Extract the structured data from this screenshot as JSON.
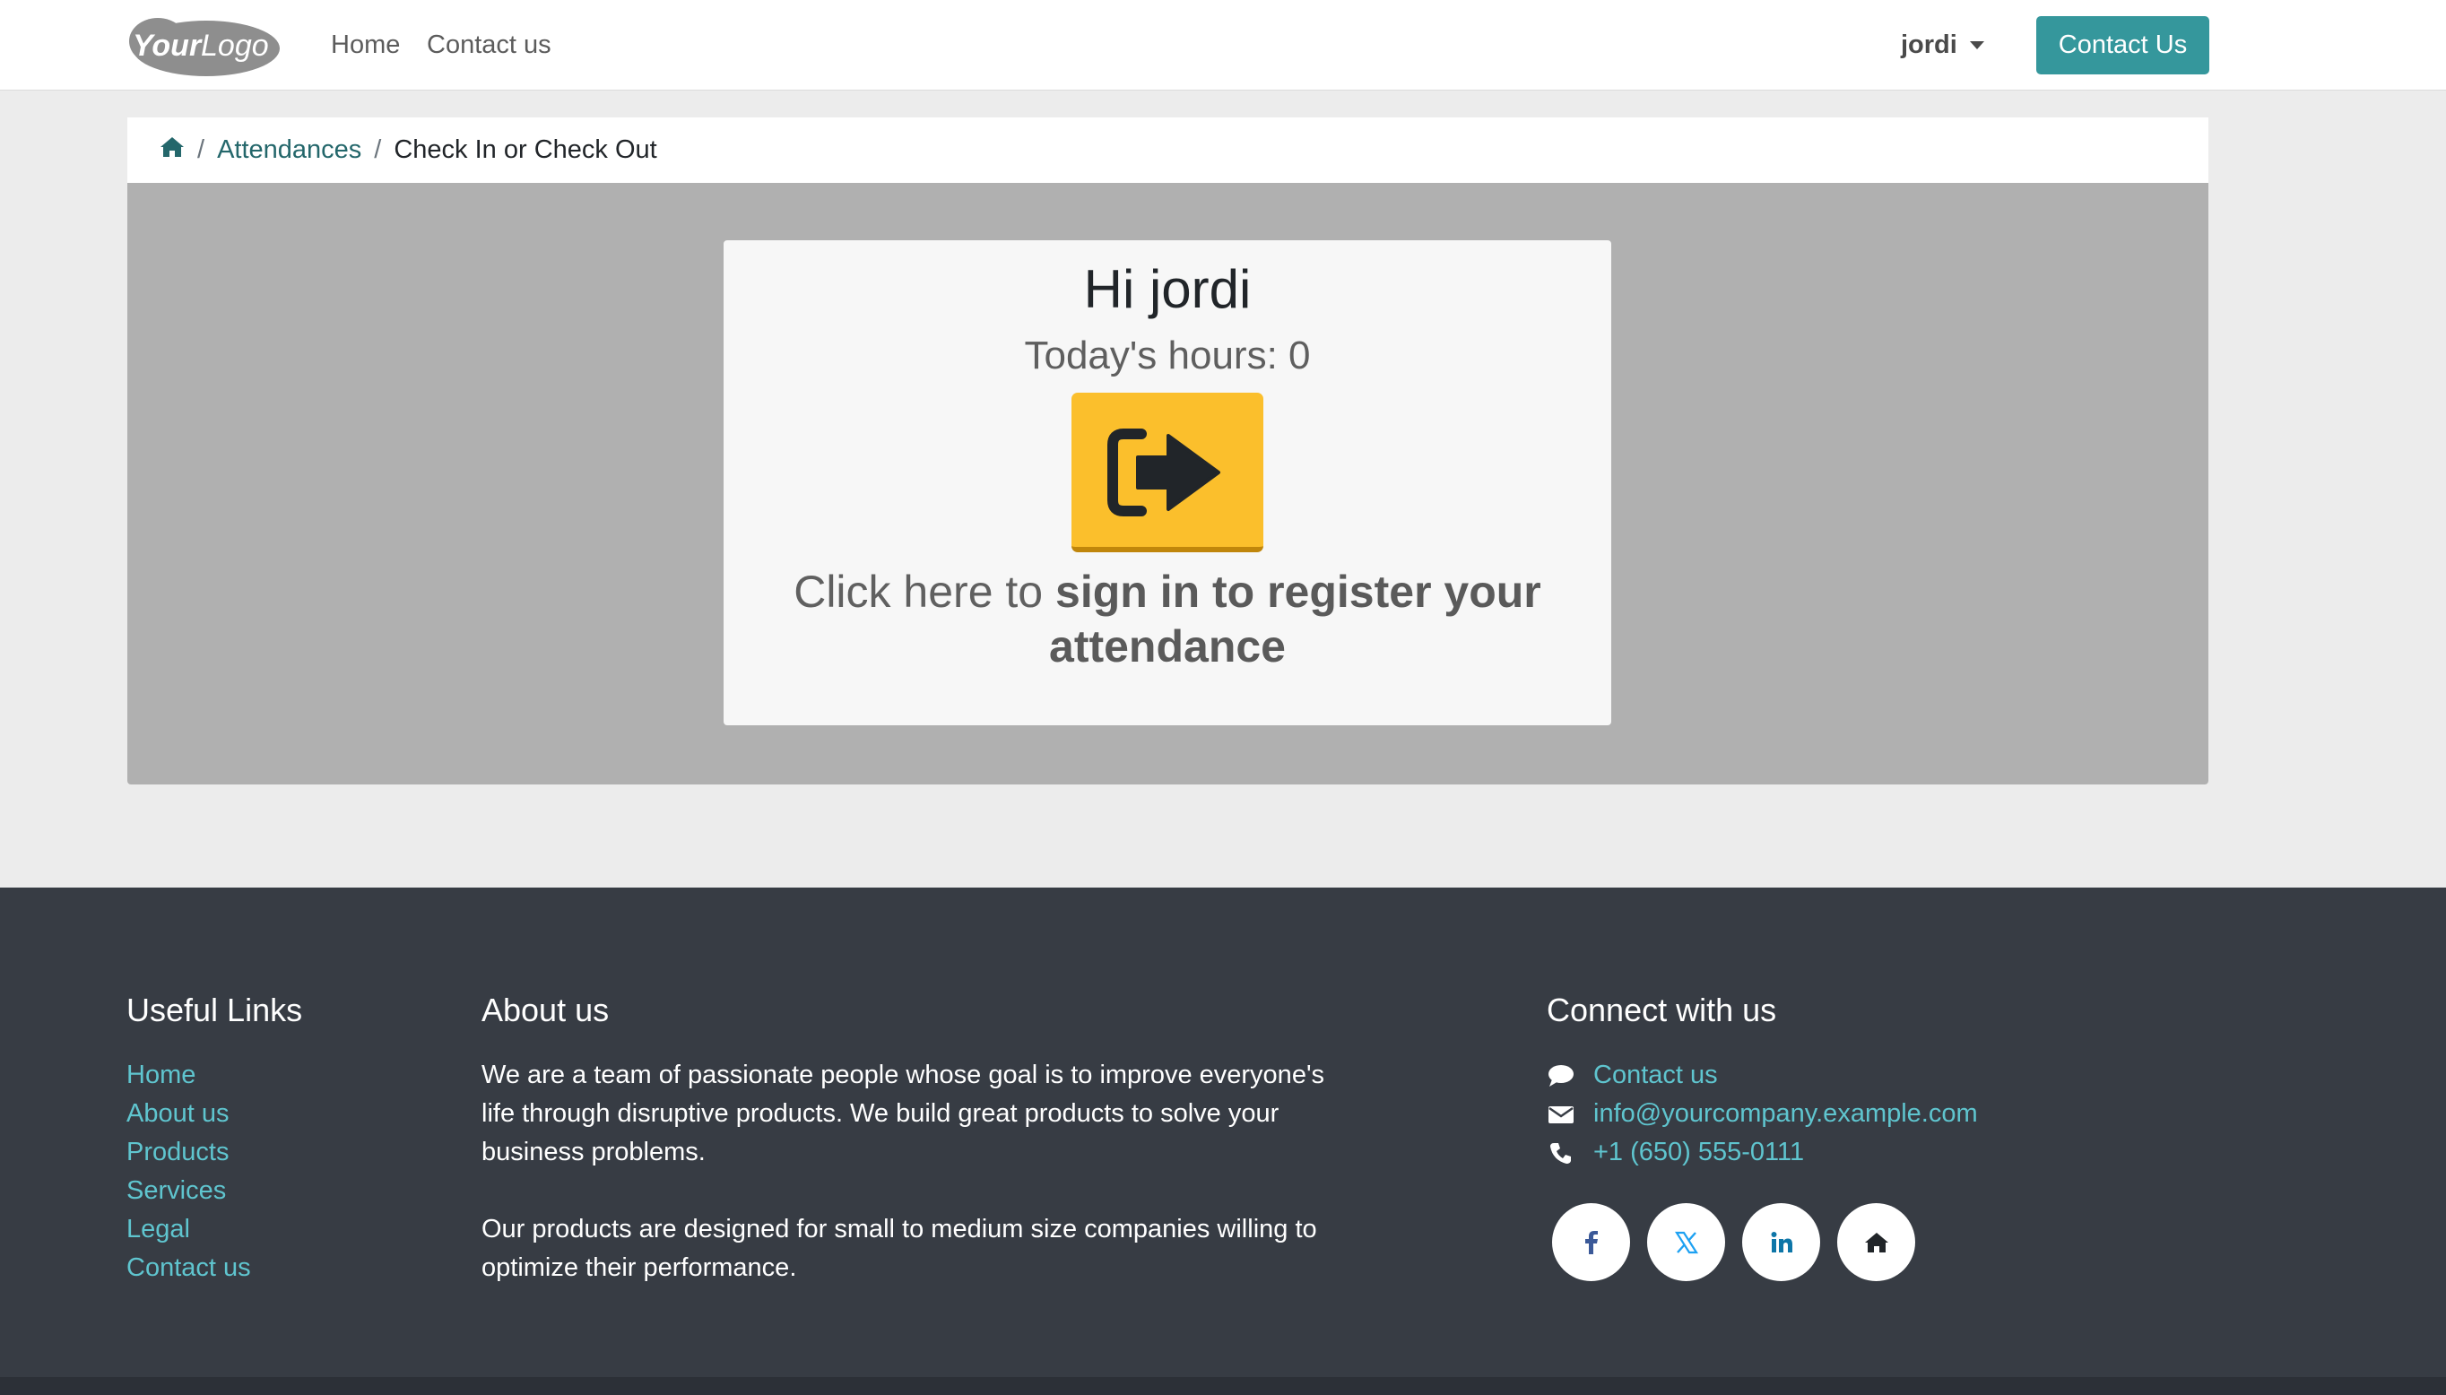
{
  "header": {
    "logo_text": "YourLogo",
    "nav": [
      {
        "label": "Home"
      },
      {
        "label": "Contact us"
      }
    ],
    "user_name": "jordi",
    "cta_label": "Contact Us"
  },
  "breadcrumb": {
    "home_icon": "home-icon",
    "items": [
      {
        "label": "Attendances"
      },
      {
        "label": "Check In or Check Out"
      }
    ]
  },
  "attendance": {
    "greeting": "Hi jordi",
    "hours_text": "Today's hours: 0",
    "button_icon": "sign-in-icon",
    "instruction_prefix": "Click here to",
    "instruction_bold": "sign in to register your attendance"
  },
  "footer": {
    "useful_links_title": "Useful Links",
    "useful_links": [
      "Home",
      "About us",
      "Products",
      "Services",
      "Legal",
      "Contact us"
    ],
    "about_title": "About us",
    "about_paragraphs": [
      "We are a team of passionate people whose goal is to improve everyone's life through disruptive products. We build great products to solve your business problems.",
      "Our products are designed for small to medium size companies willing to optimize their performance."
    ],
    "connect_title": "Connect with us",
    "contacts": [
      {
        "icon": "comment-icon",
        "label": "Contact us"
      },
      {
        "icon": "envelope-icon",
        "label": "info@yourcompany.example.com"
      },
      {
        "icon": "phone-icon",
        "label": "+1 (650) 555-0111"
      }
    ],
    "socials": [
      "facebook-icon",
      "x-twitter-icon",
      "linkedin-icon",
      "home-icon"
    ]
  },
  "colors": {
    "brand": "#35979c",
    "link": "#24676b",
    "footer_link": "#5fc5cf",
    "checkin_button": "#fbbf2c",
    "footer_bg": "#373c44"
  }
}
